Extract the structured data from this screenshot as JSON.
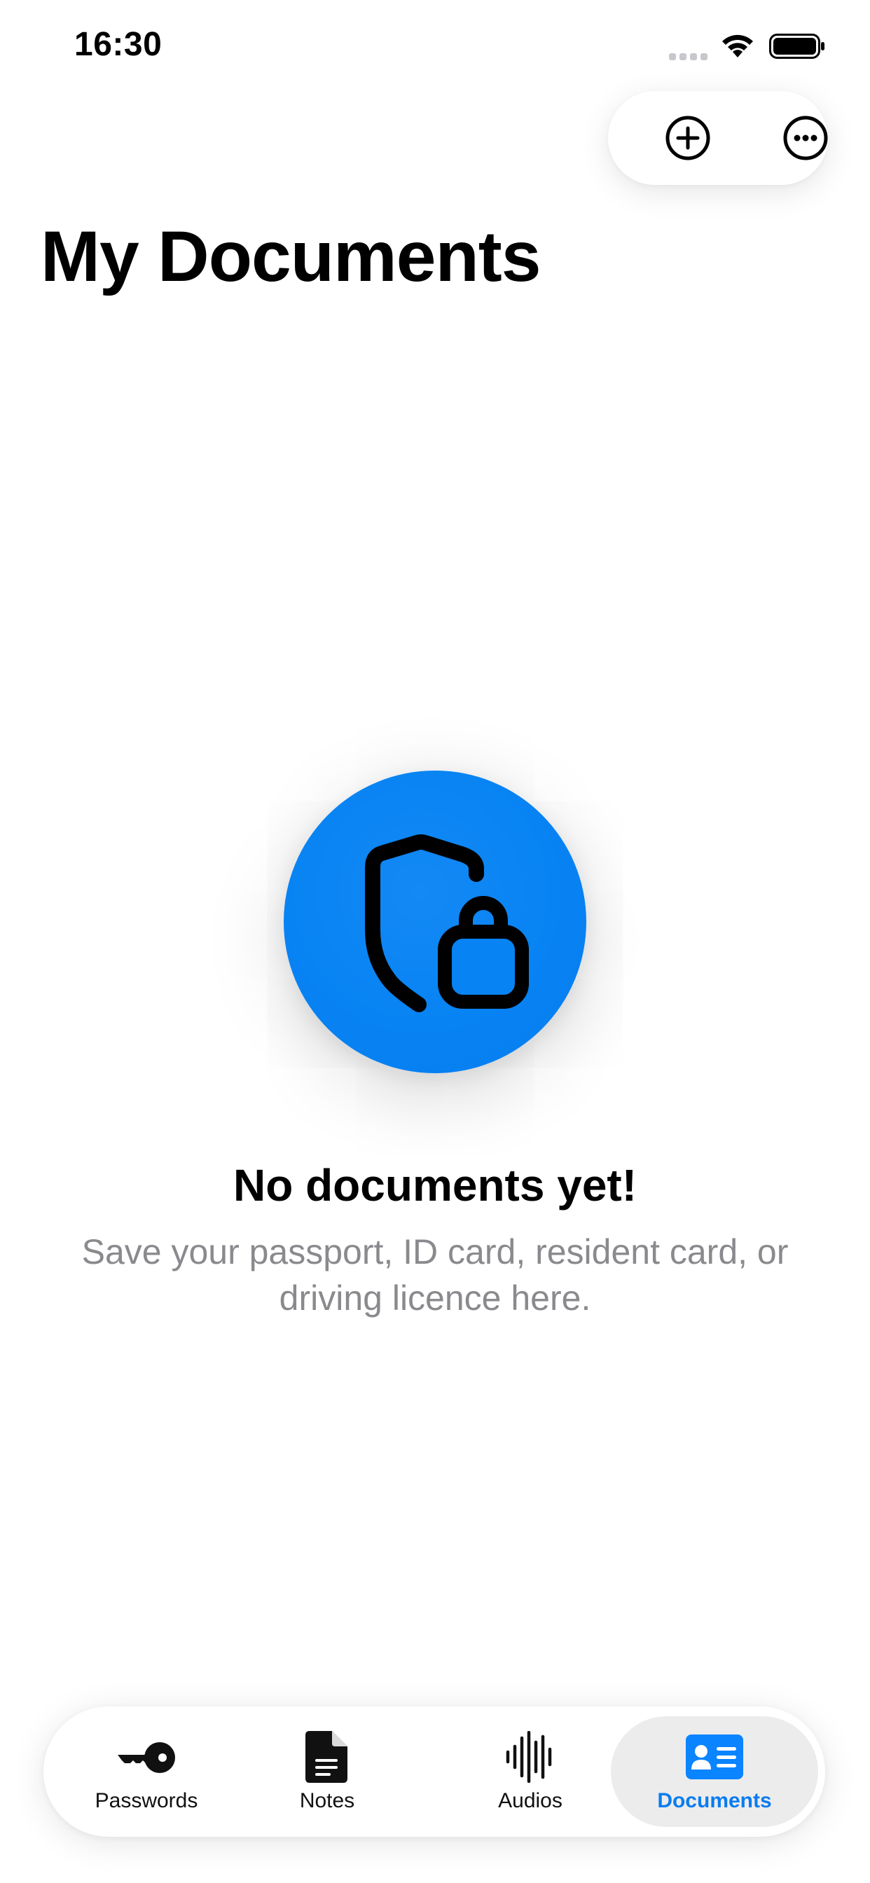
{
  "status_bar": {
    "time": "16:30"
  },
  "header": {
    "title": "My Documents",
    "actions": [
      {
        "name": "add",
        "icon": "plus-circle-icon"
      },
      {
        "name": "more",
        "icon": "ellipsis-circle-icon"
      }
    ]
  },
  "empty_state": {
    "icon": "shield-lock-icon",
    "title": "No documents yet!",
    "subtitle": "Save your passport, ID card, resident card, or driving licence here."
  },
  "tabbar": {
    "tabs": [
      {
        "label": "Passwords",
        "icon": "key-icon",
        "active": false
      },
      {
        "label": "Notes",
        "icon": "note-icon",
        "active": false
      },
      {
        "label": "Audios",
        "icon": "waveform-icon",
        "active": false
      },
      {
        "label": "Documents",
        "icon": "id-card-icon",
        "active": true
      }
    ]
  },
  "colors": {
    "accent": "#0A84FF",
    "active_tab_label": "#0A7CF0",
    "active_tab_bg": "#ECECEC",
    "subtitle_gray": "#8A8A8E"
  }
}
